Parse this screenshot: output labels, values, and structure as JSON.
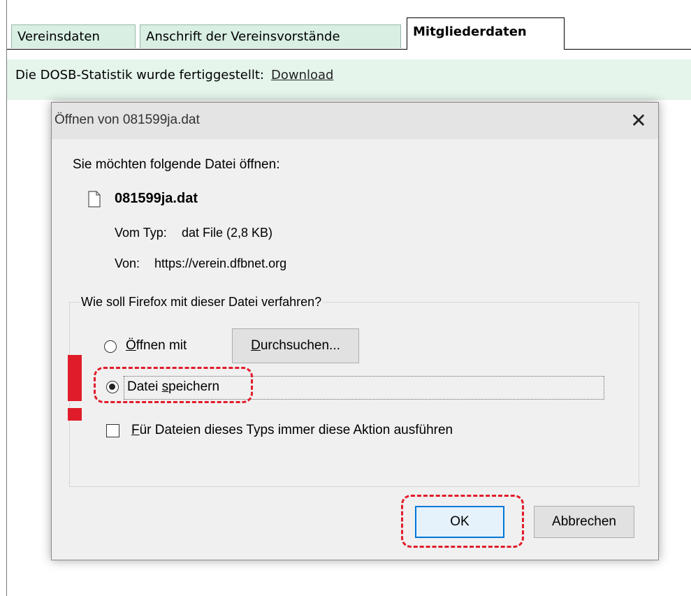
{
  "tabs": {
    "vereinsdaten": "Vereinsdaten",
    "anschrift": "Anschrift der Vereinsvorstände",
    "mitgliederdaten": "Mitgliederdaten"
  },
  "info": {
    "text": "Die DOSB-Statistik wurde fertiggestellt:",
    "link": "Download"
  },
  "dialog": {
    "title": "Öffnen von 081599ja.dat",
    "close": "✕",
    "prompt": "Sie möchten folgende Datei öffnen:",
    "file_name": "081599ja.dat",
    "type_label": "Vom Typ:",
    "type_value": "dat File (2,8 KB)",
    "from_label": "Von:",
    "from_value": "https://verein.dfbnet.org",
    "group_label": "Wie soll Firefox mit dieser Datei verfahren?",
    "open_with_prefix": "Ö",
    "open_with_rest": "ffnen mit",
    "browse_prefix": "D",
    "browse_rest": "urchsuchen...",
    "save_prefix": "Datei ",
    "save_u": "s",
    "save_rest": "peichern",
    "always_prefix": "F",
    "always_rest": "ür Dateien dieses Typs immer diese Aktion ausführen",
    "ok": "OK",
    "cancel": "Abbrechen"
  },
  "state": {
    "selected_action": "save",
    "always_checked": false
  },
  "colors": {
    "annotation": "#e11c2a",
    "tab_bg": "#d9efe4",
    "info_bg": "#e5f5ec",
    "focus_border": "#0078d7"
  }
}
